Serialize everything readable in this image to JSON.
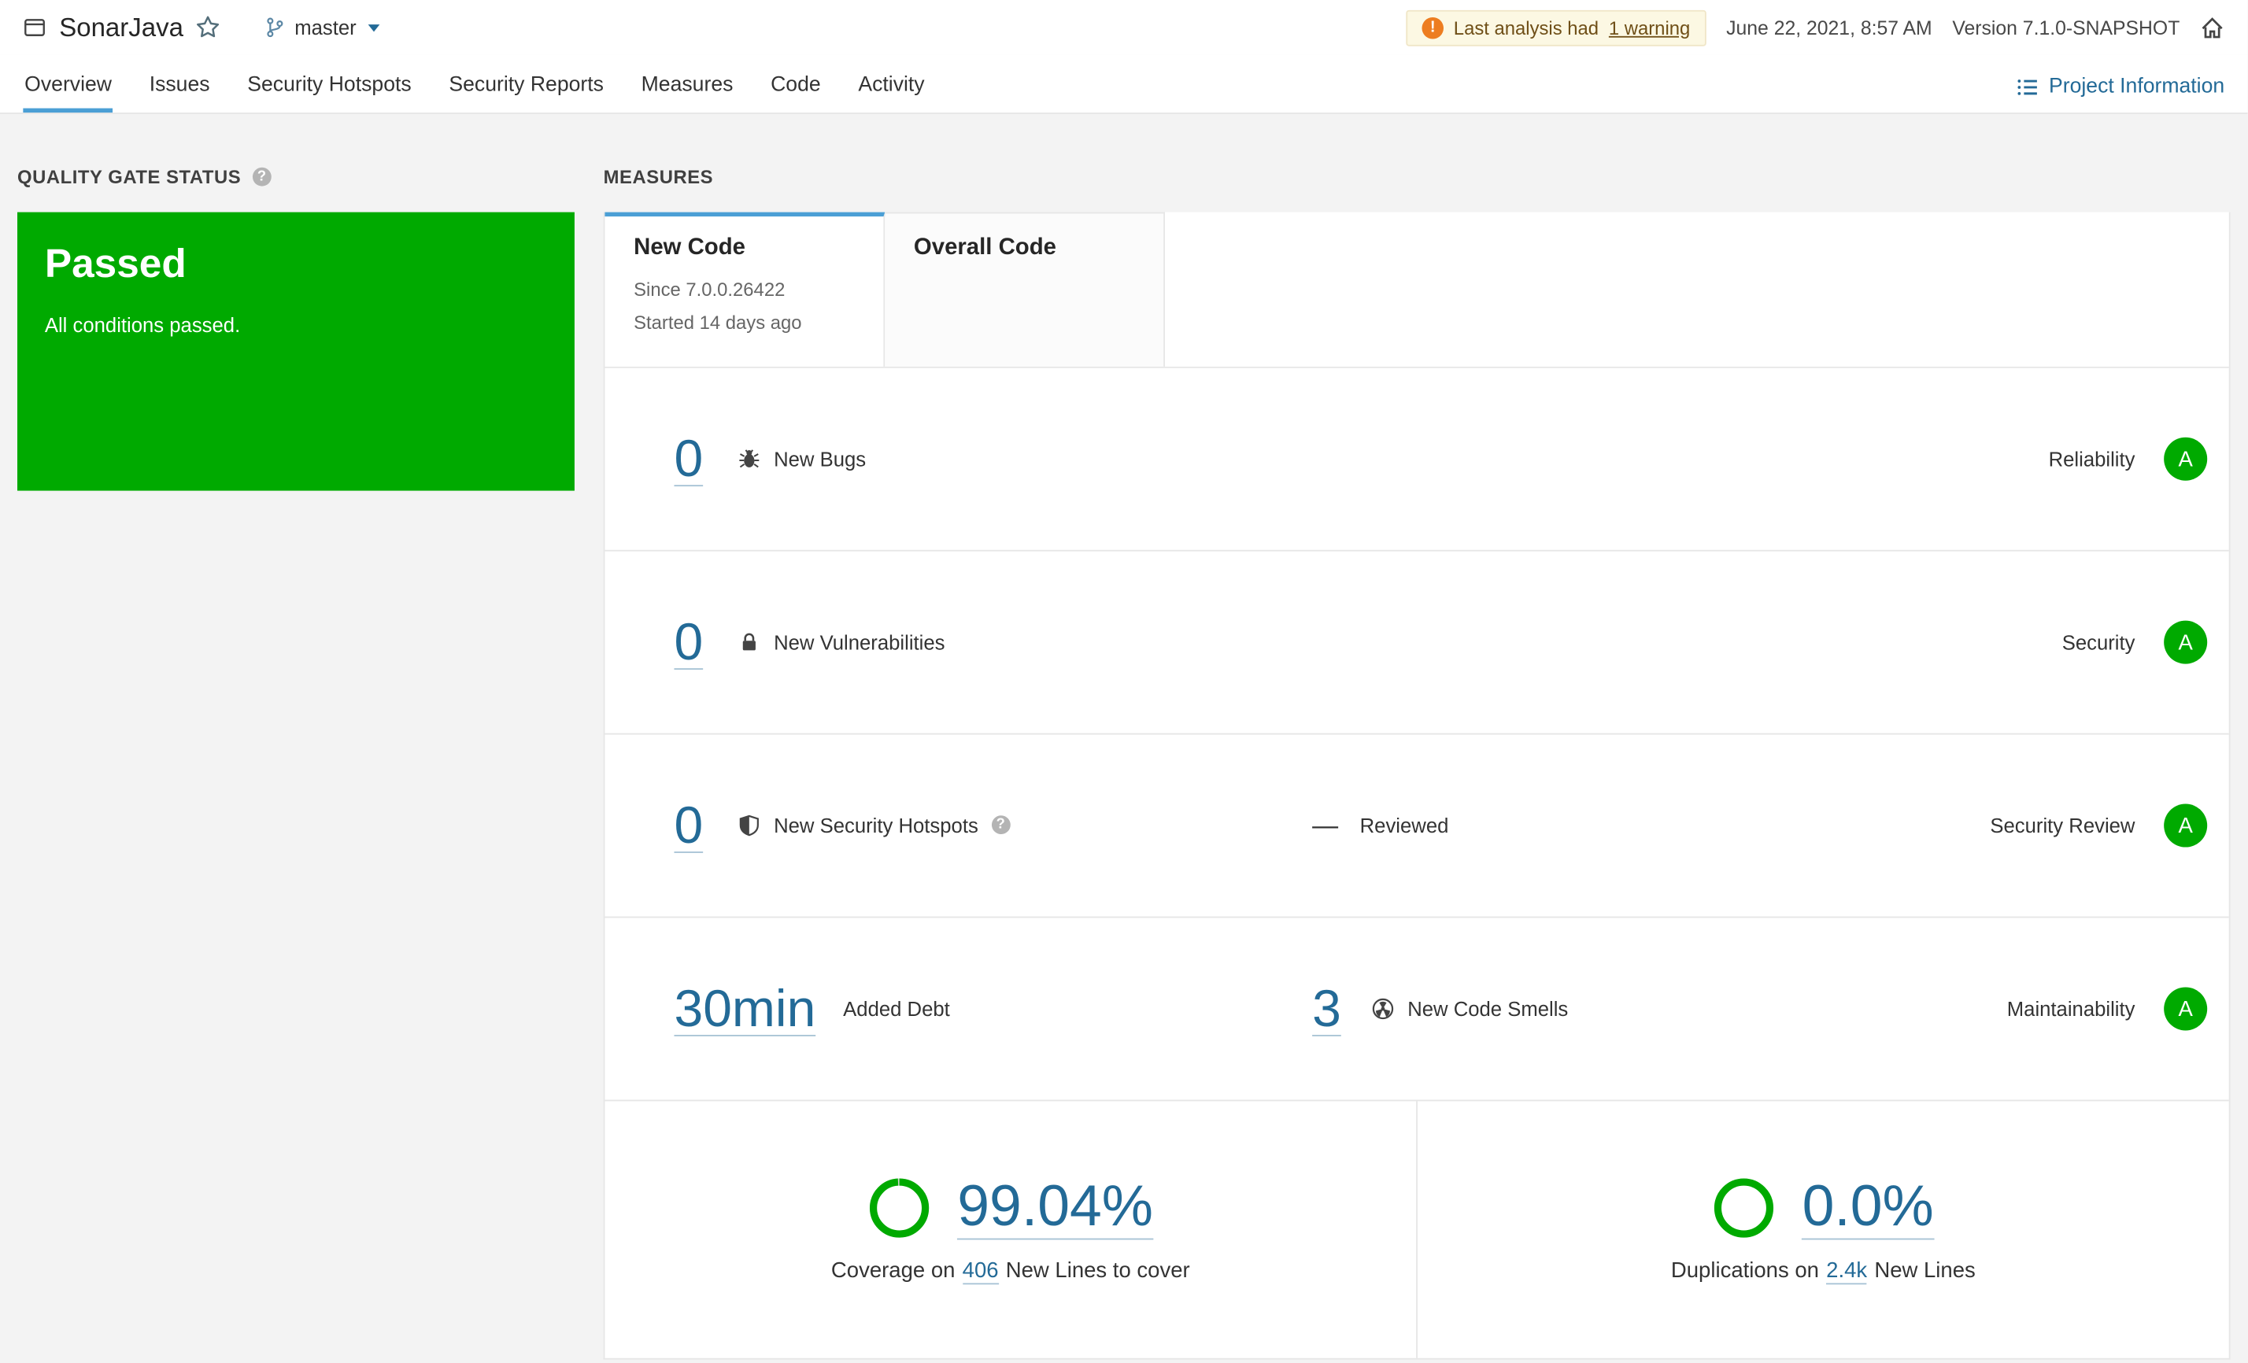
{
  "colors": {
    "accent_blue": "#236a97",
    "tab_active_blue": "#4b9fd5",
    "success_green": "#00aa00",
    "warning_orange": "#ed7d20",
    "warning_bg": "#fcf8e3"
  },
  "icons": {
    "warning_glyph": "!",
    "help_glyph": "?"
  },
  "header": {
    "project_name": "SonarJava",
    "branch": "master",
    "warning_text": "Last analysis had",
    "warning_link": "1 warning",
    "analysis_date": "June 22, 2021, 8:57 AM",
    "version": "Version 7.1.0-SNAPSHOT"
  },
  "nav": {
    "tabs": [
      {
        "label": "Overview",
        "active": true
      },
      {
        "label": "Issues"
      },
      {
        "label": "Security Hotspots"
      },
      {
        "label": "Security Reports"
      },
      {
        "label": "Measures"
      },
      {
        "label": "Code"
      },
      {
        "label": "Activity"
      }
    ],
    "project_information": "Project Information"
  },
  "quality_gate": {
    "title": "QUALITY GATE STATUS",
    "status": "Passed",
    "subtitle": "All conditions passed."
  },
  "measures": {
    "title": "MEASURES",
    "tabs": {
      "new_code": {
        "label": "New Code",
        "since": "Since 7.0.0.26422",
        "started": "Started 14 days ago"
      },
      "overall_code": {
        "label": "Overall Code"
      }
    },
    "rows": [
      {
        "value": "0",
        "label": "New Bugs",
        "domain": "Reliability",
        "rating": "A"
      },
      {
        "value": "0",
        "label": "New Vulnerabilities",
        "domain": "Security",
        "rating": "A"
      },
      {
        "value": "0",
        "label": "New Security Hotspots",
        "reviewed_value": "—",
        "reviewed_label": "Reviewed",
        "domain": "Security Review",
        "rating": "A"
      },
      {
        "value": "30min",
        "label": "Added Debt",
        "value2": "3",
        "label2": "New Code Smells",
        "domain": "Maintainability",
        "rating": "A"
      }
    ],
    "coverage": {
      "value": "99.04%",
      "percent": 99.04,
      "prefix": "Coverage on",
      "link": "406",
      "suffix": "New Lines to cover"
    },
    "duplications": {
      "value": "0.0%",
      "percent": 0.0,
      "prefix": "Duplications on",
      "link": "2.4k",
      "suffix": "New Lines"
    }
  }
}
